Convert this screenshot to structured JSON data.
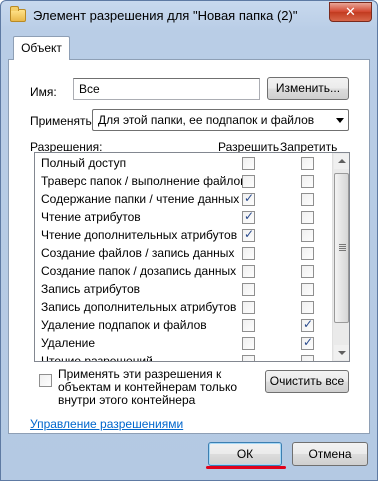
{
  "window": {
    "title": "Элемент разрешения для \"Новая папка (2)\"",
    "close_glyph": "✕"
  },
  "tabs": [
    {
      "label": "Объект"
    }
  ],
  "name_label": "Имя:",
  "name_value": "Все",
  "change_button": "Изменить...",
  "apply_label": "Применять:",
  "apply_value": "Для этой папки, ее подпапок и файлов",
  "permissions_label": "Разрешения:",
  "allow_header": "Разрешить",
  "deny_header": "Запретить",
  "permissions": [
    {
      "name": "Полный доступ",
      "allow": false,
      "deny": false
    },
    {
      "name": "Траверс папок / выполнение файлов",
      "allow": false,
      "deny": false
    },
    {
      "name": "Содержание папки / чтение данных",
      "allow": true,
      "deny": false
    },
    {
      "name": "Чтение атрибутов",
      "allow": true,
      "deny": false
    },
    {
      "name": "Чтение дополнительных атрибутов",
      "allow": true,
      "deny": false
    },
    {
      "name": "Создание файлов / запись данных",
      "allow": false,
      "deny": false
    },
    {
      "name": "Создание папок / дозапись данных",
      "allow": false,
      "deny": false
    },
    {
      "name": "Запись атрибутов",
      "allow": false,
      "deny": false
    },
    {
      "name": "Запись дополнительных атрибутов",
      "allow": false,
      "deny": false
    },
    {
      "name": "Удаление подпапок и файлов",
      "allow": false,
      "deny": true
    },
    {
      "name": "Удаление",
      "allow": false,
      "deny": true
    },
    {
      "name": "Чтение разрешений",
      "allow": false,
      "deny": false
    }
  ],
  "apply_only_checkbox": {
    "label": "Применять эти разрешения к объектам и контейнерам только внутри этого контейнера",
    "checked": false
  },
  "clear_all_button": "Очистить все",
  "manage_link": "Управление разрешениями",
  "ok_button": "ОК",
  "cancel_button": "Отмена",
  "colors": {
    "annotation_red": "#e0001a",
    "link_blue": "#0066cc"
  }
}
